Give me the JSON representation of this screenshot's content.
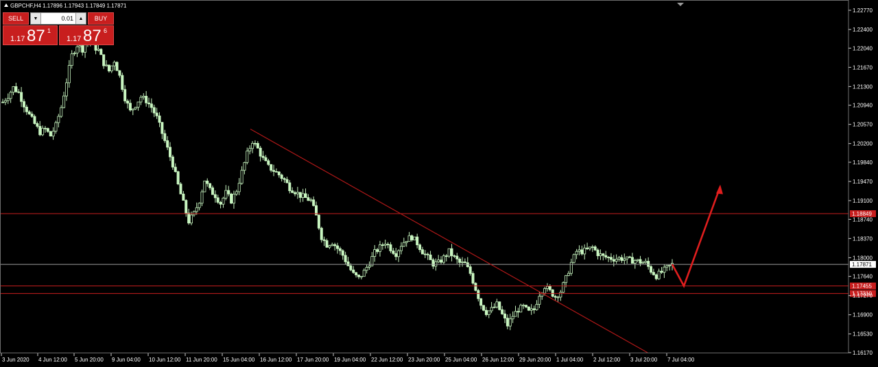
{
  "header": {
    "symbol_line": "GBPCHF,H4  1.17896 1.17943 1.17849 1.17871"
  },
  "trade_panel": {
    "sell_label": "SELL",
    "buy_label": "BUY",
    "lot_value": "0.01",
    "bid_small": "1.17",
    "bid_big": "87",
    "bid_sup": "1",
    "ask_small": "1.17",
    "ask_big": "87",
    "ask_sup": "6"
  },
  "colors": {
    "background": "#000000",
    "candle": "#c8f5c0",
    "level_line": "#c81e1e",
    "trendline": "#b01818",
    "arrow": "#e01e1e",
    "bid_line": "#a0a0a0"
  },
  "chart_data": {
    "type": "candlestick",
    "timeframe": "H4",
    "ylim": [
      1.1617,
      1.2277
    ],
    "y_ticks": [
      "1.22770",
      "1.22400",
      "1.22040",
      "1.21670",
      "1.21300",
      "1.20940",
      "1.20570",
      "1.20200",
      "1.19840",
      "1.19470",
      "1.19100",
      "1.18740",
      "1.18370",
      "1.18000",
      "1.17640",
      "1.17270",
      "1.16900",
      "1.16530",
      "1.16170"
    ],
    "x_labels": [
      "3 Jun 2020",
      "4 Jun 12:00",
      "5 Jun 20:00",
      "9 Jun 04:00",
      "10 Jun 12:00",
      "11 Jun 20:00",
      "15 Jun 04:00",
      "16 Jun 12:00",
      "17 Jun 20:00",
      "19 Jun 04:00",
      "22 Jun 12:00",
      "23 Jun 20:00",
      "25 Jun 04:00",
      "26 Jun 12:00",
      "29 Jun 20:00",
      "1 Jul 04:00",
      "2 Jul 12:00",
      "3 Jul 20:00",
      "7 Jul 04:00"
    ],
    "close_path": [
      1.21,
      1.2112,
      1.2128,
      1.2118,
      1.2095,
      1.2075,
      1.2058,
      1.2042,
      1.2048,
      1.2035,
      1.2055,
      1.209,
      1.214,
      1.219,
      1.221,
      1.2202,
      1.2225,
      1.2208,
      1.22,
      1.2175,
      1.216,
      1.218,
      1.215,
      1.2108,
      1.2082,
      1.2095,
      1.211,
      1.2103,
      1.209,
      1.207,
      1.204,
      1.201,
      1.198,
      1.194,
      1.1905,
      1.187,
      1.1885,
      1.191,
      1.195,
      1.193,
      1.192,
      1.1905,
      1.1925,
      1.191,
      1.193,
      1.1965,
      1.2,
      1.2025,
      1.201,
      1.199,
      1.1975,
      1.1968,
      1.196,
      1.195,
      1.1935,
      1.1928,
      1.192,
      1.1915,
      1.191,
      1.188,
      1.184,
      1.1825,
      1.183,
      1.1818,
      1.1805,
      1.1785,
      1.1768,
      1.176,
      1.1773,
      1.179,
      1.181,
      1.182,
      1.183,
      1.1818,
      1.1808,
      1.1825,
      1.1836,
      1.184,
      1.1828,
      1.1812,
      1.18,
      1.1788,
      1.179,
      1.18,
      1.1812,
      1.18,
      1.179,
      1.1788,
      1.177,
      1.174,
      1.171,
      1.1695,
      1.17,
      1.171,
      1.169,
      1.167,
      1.1688,
      1.17,
      1.1705,
      1.1695,
      1.17,
      1.173,
      1.1745,
      1.1735,
      1.1725,
      1.1735,
      1.176,
      1.179,
      1.1812,
      1.1812,
      1.1815,
      1.182,
      1.1808,
      1.1802,
      1.18,
      1.1798,
      1.1799,
      1.1798,
      1.1795,
      1.1795,
      1.1792,
      1.179,
      1.1775,
      1.1765,
      1.1772,
      1.178,
      1.1787
    ],
    "horizontal_levels": [
      {
        "price": 1.18849,
        "label": "1.18849"
      },
      {
        "price": 1.17455,
        "label": "1.17455"
      },
      {
        "price": 1.1731,
        "label": "1.17310"
      }
    ],
    "current_price": {
      "price": 1.17871,
      "label": "1.17871"
    },
    "trendline": {
      "from": {
        "x": "15 Jun 04:00",
        "price": 1.2048
      },
      "to": {
        "x": "7 Jul 04:00",
        "price": 1.1617
      }
    },
    "projection_arrow": [
      {
        "x": "7 Jul 04:00",
        "price": 1.17871
      },
      {
        "x": "after 7 Jul 04:00",
        "price": 1.17455
      },
      {
        "x": "after 7 Jul 04:00",
        "price": 1.1937
      }
    ],
    "grid": false
  }
}
